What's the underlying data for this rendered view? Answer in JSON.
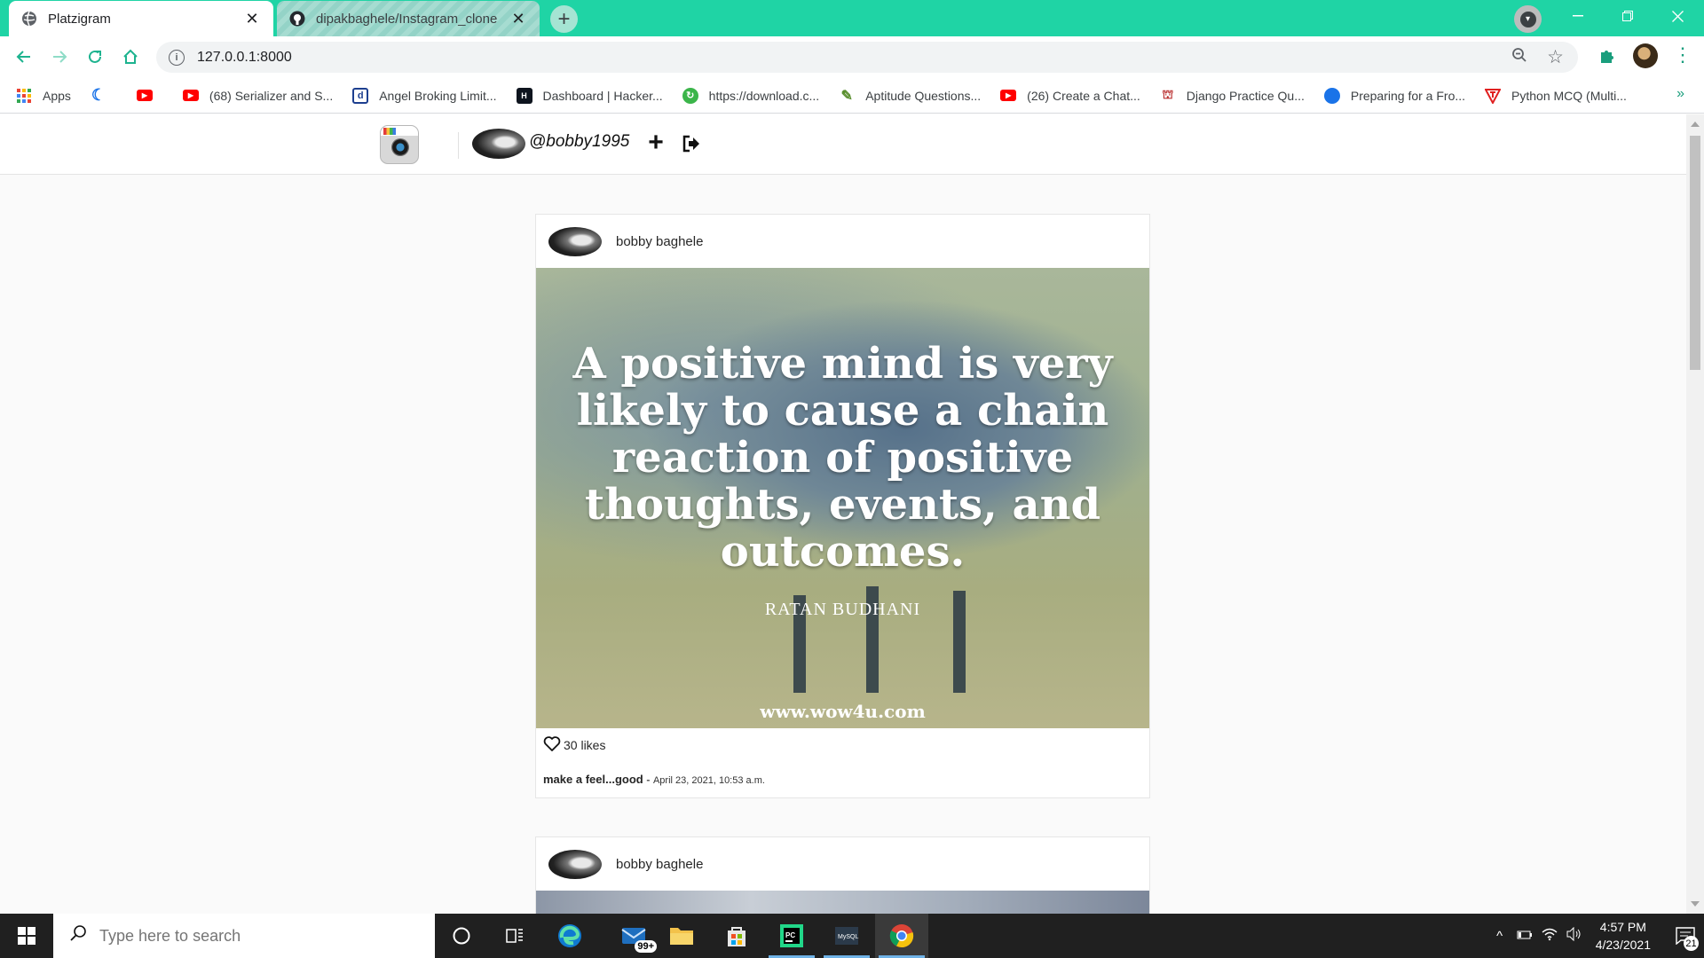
{
  "browser": {
    "tabs": [
      {
        "title": "Platzigram",
        "active": true,
        "icon": "globe-icon"
      },
      {
        "title": "dipakbaghele/Instagram_clone",
        "active": false,
        "icon": "github-icon"
      }
    ],
    "new_tab_label": "+",
    "address": "127.0.0.1:8000",
    "accent_color": "#1fd4a5"
  },
  "bookmarks": [
    {
      "label": "Apps",
      "icon": "apps-grid-icon",
      "color": "#e94235"
    },
    {
      "label": "",
      "icon": "moon-icon",
      "color": "#1a73e8"
    },
    {
      "label": "",
      "icon": "youtube-icon",
      "color": "#ff0000"
    },
    {
      "label": "(68) Serializer and S...",
      "icon": "youtube-icon",
      "color": "#ff0000"
    },
    {
      "label": "Angel Broking Limit...",
      "icon": "d-logo-icon",
      "color": "#1d3f8f"
    },
    {
      "label": "Dashboard | Hacker...",
      "icon": "hackerrank-icon",
      "color": "#0e141e"
    },
    {
      "label": "https://download.c...",
      "icon": "download-site-icon",
      "color": "#3bb54a"
    },
    {
      "label": "Aptitude Questions...",
      "icon": "aptitude-icon",
      "color": "#5a8f2e"
    },
    {
      "label": "(26) Create a Chat...",
      "icon": "youtube-icon",
      "color": "#ff0000"
    },
    {
      "label": "Django Practice Qu...",
      "icon": "django-icon",
      "color": "#b33"
    },
    {
      "label": "Preparing for a Fro...",
      "icon": "globe-blue-icon",
      "color": "#1a73e8"
    },
    {
      "label": "Python MCQ (Multi...",
      "icon": "tutorial-icon",
      "color": "#e02020"
    }
  ],
  "bookmarks_more": "»",
  "site": {
    "username": "@bobby1995",
    "add_symbol": "+"
  },
  "posts": [
    {
      "author": "bobby baghele",
      "quote": "A positive mind is very likely to cause a chain reaction of positive thoughts, events, and outcomes.",
      "quote_author": "RATAN BUDHANI",
      "watermark": "www.wow4u.com",
      "likes": "30 likes",
      "caption": "make a feel...good",
      "separator": "-",
      "date": "April 23, 2021, 10:53 a.m."
    },
    {
      "author": "bobby baghele"
    }
  ],
  "taskbar": {
    "search_placeholder": "Type here to search",
    "time": "4:57 PM",
    "date": "4/23/2021",
    "mail_badge": "99+",
    "notification_count": "21"
  }
}
